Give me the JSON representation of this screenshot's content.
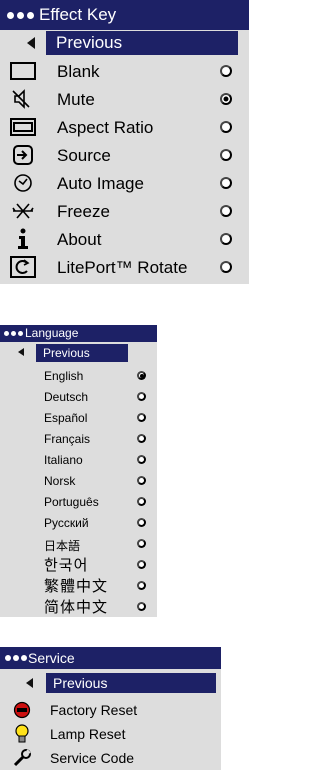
{
  "effect_key_menu": {
    "title": "Effect Key",
    "previous": "Previous",
    "items": [
      {
        "label": "Blank",
        "icon": "blank-screen-icon",
        "selected": false
      },
      {
        "label": "Mute",
        "icon": "mute-speaker-icon",
        "selected": true
      },
      {
        "label": "Aspect Ratio",
        "icon": "aspect-ratio-icon",
        "selected": false
      },
      {
        "label": "Source",
        "icon": "source-input-icon",
        "selected": false
      },
      {
        "label": "Auto Image",
        "icon": "auto-image-icon",
        "selected": false
      },
      {
        "label": "Freeze",
        "icon": "snowflake-icon",
        "selected": false
      },
      {
        "label": "About",
        "icon": "info-icon",
        "selected": false
      },
      {
        "label": "LitePort™ Rotate",
        "icon": "rotate-icon",
        "selected": false
      }
    ]
  },
  "language_menu": {
    "title": "Language",
    "previous": "Previous",
    "items": [
      {
        "label": "English",
        "selected": true
      },
      {
        "label": "Deutsch",
        "selected": false
      },
      {
        "label": "Español",
        "selected": false
      },
      {
        "label": "Français",
        "selected": false
      },
      {
        "label": "Italiano",
        "selected": false
      },
      {
        "label": "Norsk",
        "selected": false
      },
      {
        "label": "Português",
        "selected": false
      },
      {
        "label": "Русский",
        "selected": false
      },
      {
        "label": "日本語",
        "selected": false
      },
      {
        "label": "한국어",
        "selected": false
      },
      {
        "label": "繁體中文",
        "selected": false
      },
      {
        "label": "简体中文",
        "selected": false
      }
    ]
  },
  "service_menu": {
    "title": "Service",
    "previous": "Previous",
    "items": [
      {
        "label": "Factory Reset",
        "icon": "factory-reset-icon"
      },
      {
        "label": "Lamp Reset",
        "icon": "lamp-bulb-icon"
      },
      {
        "label": "Service Code",
        "icon": "wrench-icon"
      }
    ]
  },
  "colors": {
    "title_bar": "#1d2166",
    "menu_background": "#dddddd",
    "text": "#000000",
    "highlight_text": "#ffffff"
  }
}
